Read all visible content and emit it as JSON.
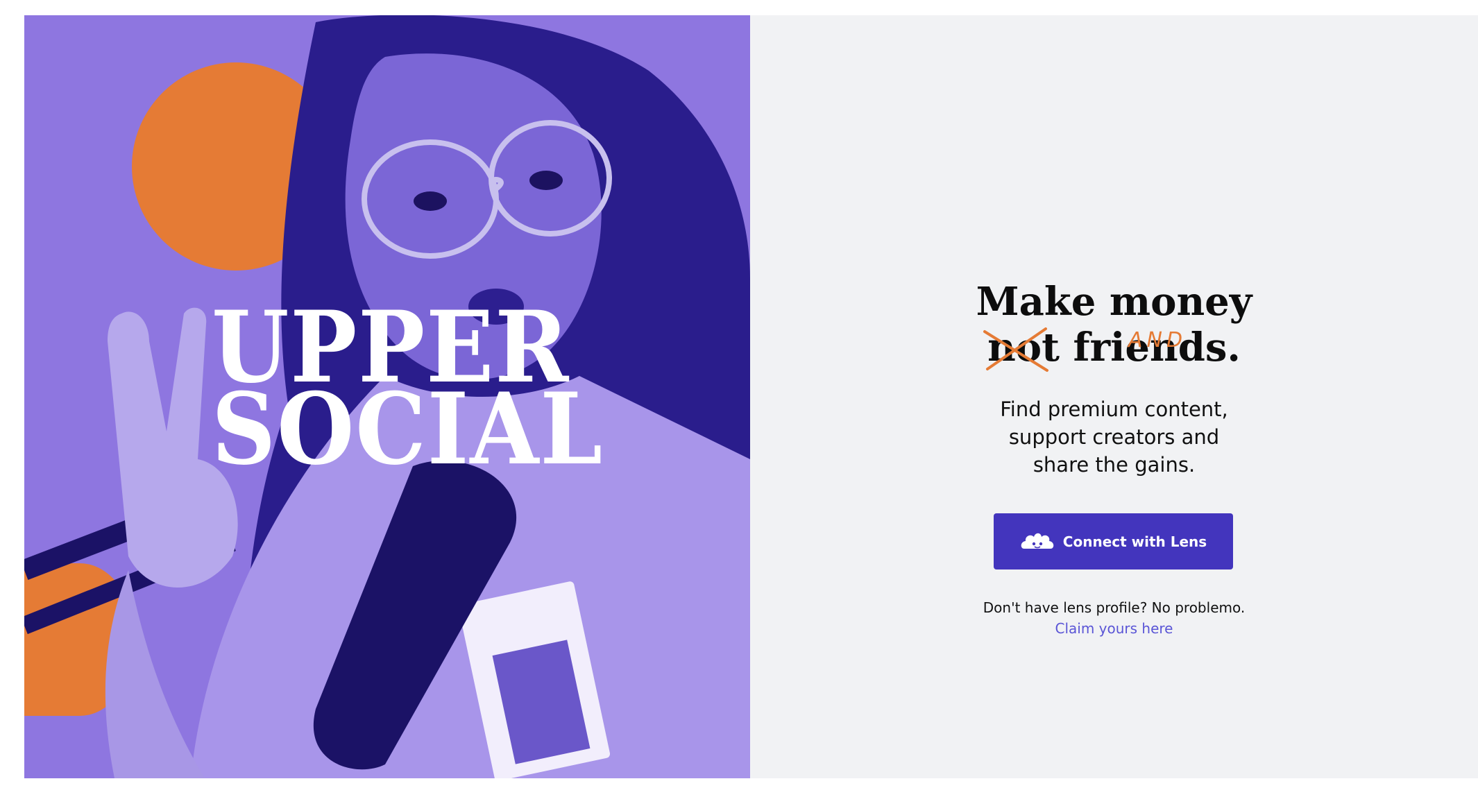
{
  "hero": {
    "brand_line_1": "UPPER",
    "brand_line_2": "SOCIAL",
    "panel_color": "#8e76e0",
    "accent_color": "#e57b35",
    "photo_description_icon": "creator-photo"
  },
  "headline": {
    "row1_word1": "Make",
    "row1_word2": "money",
    "row2_struck": "not",
    "row2_rest": "friends.",
    "insert_word": "AND"
  },
  "subtitle": {
    "line1": "Find premium content,",
    "line2": "support creators and",
    "line3": "share the gains."
  },
  "connect": {
    "label": "Connect with Lens",
    "icon": "lens-icon",
    "color": "#4335bd"
  },
  "footer": {
    "no_profile": "Don't have lens profile? No problemo.",
    "claim_link": "Claim yours here",
    "link_color": "#5a55d6"
  }
}
